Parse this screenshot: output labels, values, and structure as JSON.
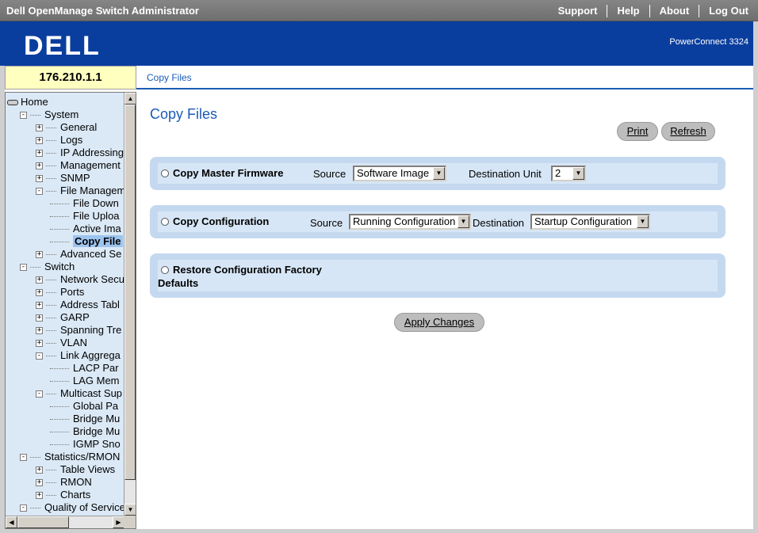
{
  "titlebar": {
    "title": "Dell OpenManage Switch Administrator",
    "links": [
      "Support",
      "Help",
      "About",
      "Log Out"
    ]
  },
  "header": {
    "logo": "DELL",
    "model": "PowerConnect 3324",
    "bg_color": "#0a3e9e"
  },
  "ip": "176.210.1.1",
  "breadcrumb": "Copy Files",
  "tree": [
    {
      "label": "Home",
      "level": 0,
      "icon": "home-icon"
    },
    {
      "label": "System",
      "level": 1,
      "toggle": "-"
    },
    {
      "label": "General",
      "level": 2,
      "toggle": "+"
    },
    {
      "label": "Logs",
      "level": 2,
      "toggle": "+"
    },
    {
      "label": "IP Addressing",
      "level": 2,
      "toggle": "+"
    },
    {
      "label": "Management",
      "level": 2,
      "toggle": "+"
    },
    {
      "label": "SNMP",
      "level": 2,
      "toggle": "+"
    },
    {
      "label": "File Managem",
      "level": 2,
      "toggle": "-"
    },
    {
      "label": "File Down",
      "level": 3
    },
    {
      "label": "File Uploa",
      "level": 3
    },
    {
      "label": "Active Ima",
      "level": 3
    },
    {
      "label": "Copy File",
      "level": 3,
      "selected": true
    },
    {
      "label": "Advanced Se",
      "level": 2,
      "toggle": "+"
    },
    {
      "label": "Switch",
      "level": 1,
      "toggle": "-"
    },
    {
      "label": "Network Secu",
      "level": 2,
      "toggle": "+"
    },
    {
      "label": "Ports",
      "level": 2,
      "toggle": "+"
    },
    {
      "label": "Address Tabl",
      "level": 2,
      "toggle": "+"
    },
    {
      "label": "GARP",
      "level": 2,
      "toggle": "+"
    },
    {
      "label": "Spanning Tre",
      "level": 2,
      "toggle": "+"
    },
    {
      "label": "VLAN",
      "level": 2,
      "toggle": "+"
    },
    {
      "label": "Link Aggrega",
      "level": 2,
      "toggle": "-"
    },
    {
      "label": "LACP Par",
      "level": 3
    },
    {
      "label": "LAG Mem",
      "level": 3
    },
    {
      "label": "Multicast Sup",
      "level": 2,
      "toggle": "-"
    },
    {
      "label": "Global Pa",
      "level": 3
    },
    {
      "label": "Bridge Mu",
      "level": 3
    },
    {
      "label": "Bridge Mu",
      "level": 3
    },
    {
      "label": "IGMP Sno",
      "level": 3
    },
    {
      "label": "Statistics/RMON",
      "level": 1,
      "toggle": "-"
    },
    {
      "label": "Table Views",
      "level": 2,
      "toggle": "+"
    },
    {
      "label": "RMON",
      "level": 2,
      "toggle": "+"
    },
    {
      "label": "Charts",
      "level": 2,
      "toggle": "+"
    },
    {
      "label": "Quality of Service",
      "level": 1,
      "toggle": "-"
    }
  ],
  "main": {
    "title": "Copy Files",
    "print_label": "Print",
    "refresh_label": "Refresh",
    "apply_label": "Apply Changes",
    "copy_master": {
      "label": "Copy Master Firmware",
      "source_label": "Source",
      "source_value": "Software Image",
      "dest_label": "Destination Unit",
      "dest_value": "2"
    },
    "copy_config": {
      "label": "Copy Configuration",
      "source_label": "Source",
      "source_value": "Running Configuration",
      "dest_label": "Destination",
      "dest_value": "Startup Configuration"
    },
    "restore": {
      "label_line1": "Restore Configuration Factory",
      "label_line2": "Defaults"
    }
  },
  "colors": {
    "accent": "#1b5bb5",
    "section_bg": "#c4d9ef",
    "tree_bg": "#dbe9f6",
    "ip_bg": "#ffffc0"
  }
}
